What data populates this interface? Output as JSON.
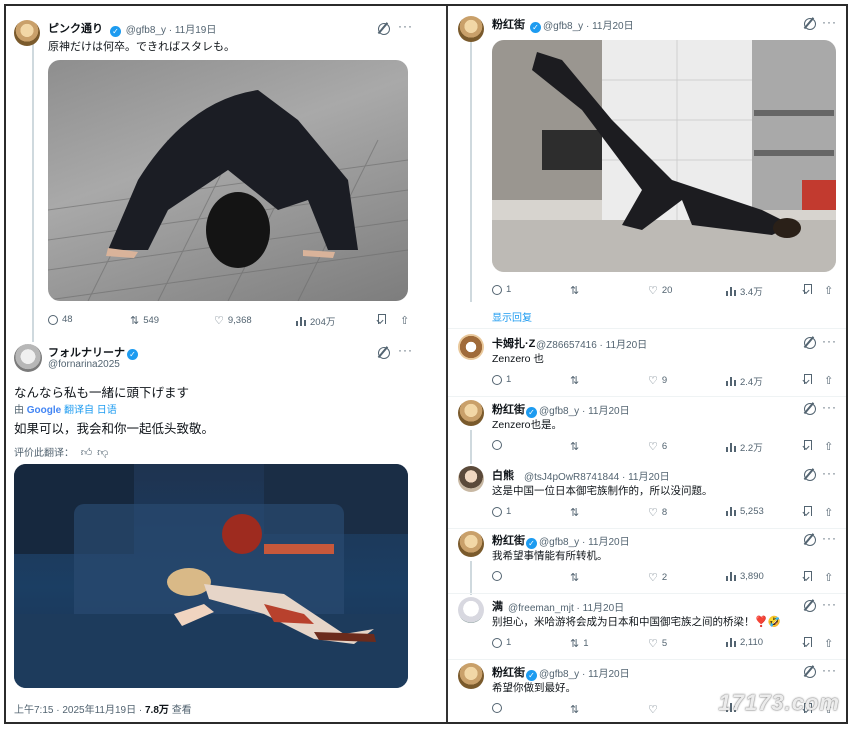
{
  "left": {
    "tweet1": {
      "display_name": "ピンク通り",
      "handle": "@gfb8_y",
      "date": "11月19日",
      "text": "原神だけは何卒。できればスタレも。",
      "stats": {
        "replies": "48",
        "retweets": "549",
        "likes": "9,368",
        "views": "204万"
      }
    },
    "tweet2": {
      "display_name": "フォルナリーナ",
      "handle": "@fornarina2025",
      "text": "なんなら私も一緒に頭下げます",
      "translated_by_prefix": "由",
      "translated_by_brand": "Google",
      "translated_by_suffix": "翻译自 日语",
      "translation": "如果可以，我会和你一起低头致敬。",
      "rate_translation": "评价此翻译：",
      "footer_time": "上午7:15 · 2025年11月19日",
      "footer_views": "7.8万",
      "footer_views_label": "查看"
    }
  },
  "right": {
    "tweets": [
      {
        "name": "粉红街",
        "handle": "@gfb8_y",
        "date": "11月20日",
        "text": "",
        "stats": {
          "replies": "1",
          "retweets": "",
          "likes": "20",
          "views": "3.4万"
        },
        "show_replies": "显示回复"
      },
      {
        "name": "卡姆扎·Z",
        "handle": "@Z86657416",
        "date": "11月20日",
        "text": "Zenzero 也",
        "stats": {
          "replies": "1",
          "retweets": "",
          "likes": "9",
          "views": "2.4万"
        }
      },
      {
        "name": "粉红街",
        "handle": "@gfb8_y",
        "date": "11月20日",
        "text": "Zenzero也是。",
        "stats": {
          "replies": "",
          "retweets": "",
          "likes": "6",
          "views": "2.2万"
        }
      },
      {
        "name": "白熊",
        "handle": "@tsJ4pOwR8741844",
        "date": "11月20日",
        "text": "这是中国一位日本御宅族制作的，所以没问题。",
        "stats": {
          "replies": "1",
          "retweets": "",
          "likes": "8",
          "views": "5,253"
        }
      },
      {
        "name": "粉红街",
        "handle": "@gfb8_y",
        "date": "11月20日",
        "text": "我希望事情能有所转机。",
        "stats": {
          "replies": "",
          "retweets": "",
          "likes": "2",
          "views": "3,890"
        }
      },
      {
        "name": "满",
        "handle": "@freeman_mjt",
        "date": "11月20日",
        "text": "别担心，米哈游将会成为日本和中国御宅族之间的桥梁！❣️🤣",
        "stats": {
          "replies": "1",
          "retweets": "1",
          "likes": "5",
          "views": "2,110"
        }
      },
      {
        "name": "粉红街",
        "handle": "@gfb8_y",
        "date": "11月20日",
        "text": "希望你做到最好。",
        "stats": {
          "replies": "",
          "retweets": "",
          "likes": "",
          "views": ""
        }
      }
    ]
  },
  "watermark": "17173.com",
  "colors": {
    "accent": "#1d9bf0",
    "muted": "#536471",
    "text": "#0f1419",
    "border": "#2b2b2b"
  }
}
